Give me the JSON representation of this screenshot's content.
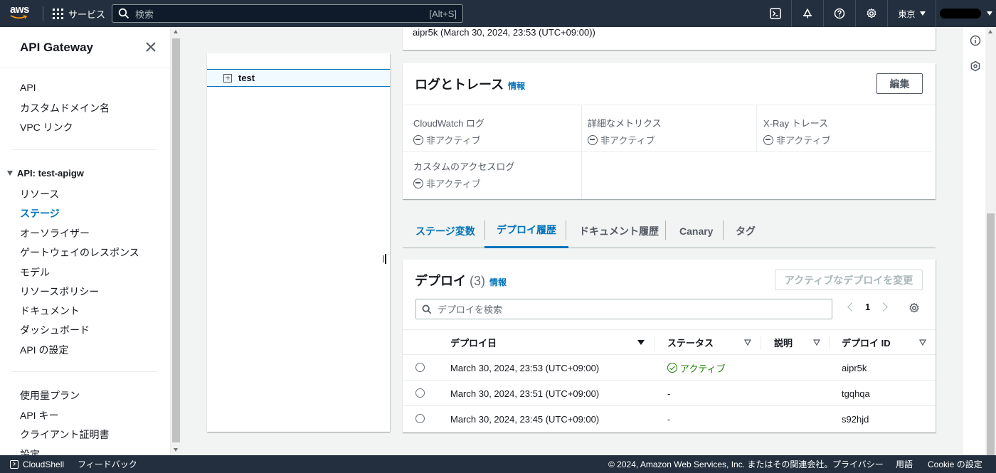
{
  "topnav": {
    "logo_text": "aws",
    "services_label": "サービス",
    "search_placeholder": "検索",
    "search_shortcut": "[Alt+S]",
    "region": "東京",
    "icons": [
      "cloudshell-icon",
      "bell-icon",
      "help-icon",
      "settings-icon"
    ]
  },
  "sidebar": {
    "title": "API Gateway",
    "top_items": [
      "API",
      "カスタムドメイン名",
      "VPC リンク"
    ],
    "section_title": "API: test-apigw",
    "api_items": [
      "リソース",
      "ステージ",
      "オーソライザー",
      "ゲートウェイのレスポンス",
      "モデル",
      "リソースポリシー",
      "ドキュメント",
      "ダッシュボード",
      "API の設定"
    ],
    "active_item": "ステージ",
    "bottom_items": [
      "使用量プラン",
      "API キー",
      "クライアント証明書",
      "設定"
    ]
  },
  "tree": {
    "node_label": "test"
  },
  "top_card": {
    "text": "aipr5k (March 30, 2024, 23:53 (UTC+09:00))"
  },
  "logs": {
    "title": "ログとトレース",
    "info": "情報",
    "edit_button": "編集",
    "fields": [
      {
        "key": "CloudWatch ログ",
        "value": "非アクティブ"
      },
      {
        "key": "詳細なメトリクス",
        "value": "非アクティブ"
      },
      {
        "key": "X-Ray トレース",
        "value": "非アクティブ"
      },
      {
        "key": "カスタムのアクセスログ",
        "value": "非アクティブ"
      }
    ]
  },
  "tabs": [
    {
      "label": "ステージ変数"
    },
    {
      "label": "デプロイ履歴"
    },
    {
      "label": "ドキュメント履歴"
    },
    {
      "label": "Canary"
    },
    {
      "label": "タグ"
    }
  ],
  "deployments": {
    "title": "デプロイ",
    "count": "(3)",
    "info": "情報",
    "change_button": "アクティブなデプロイを変更",
    "search_placeholder": "デプロイを検索",
    "page": "1",
    "columns": [
      "デプロイ日",
      "ステータス",
      "説明",
      "デプロイ ID"
    ],
    "rows": [
      {
        "date": "March 30, 2024, 23:53 (UTC+09:00)",
        "status": "アクティブ",
        "description": "",
        "id": "aipr5k"
      },
      {
        "date": "March 30, 2024, 23:51 (UTC+09:00)",
        "status": "-",
        "description": "",
        "id": "tgqhqa"
      },
      {
        "date": "March 30, 2024, 23:45 (UTC+09:00)",
        "status": "-",
        "description": "",
        "id": "s92hjd"
      }
    ]
  },
  "footer": {
    "cloudshell": "CloudShell",
    "feedback": "フィードバック",
    "copyright": "© 2024, Amazon Web Services, Inc. またはその関連会社。",
    "privacy": "プライバシー",
    "terms": "用語",
    "cookie": "Cookie の設定"
  },
  "colors": {
    "nav_bg": "#232f3e",
    "link_blue": "#0073bb",
    "success_green": "#1d8102"
  }
}
